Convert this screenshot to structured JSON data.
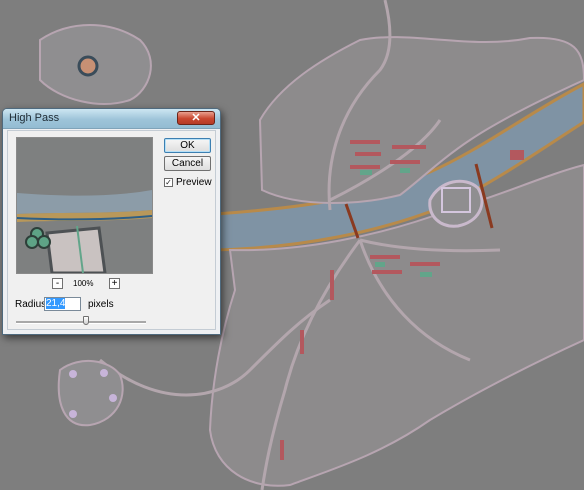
{
  "dialog": {
    "title": "High Pass",
    "close_glyph": "✕",
    "ok_label": "OK",
    "cancel_label": "Cancel",
    "preview_label": "Preview",
    "preview_checked": true,
    "check_glyph": "✓",
    "zoom_out": "-",
    "zoom_in": "+",
    "zoom_level": "100%",
    "radius_label": "Radius:",
    "radius_value": "21,4",
    "radius_unit": "pixels",
    "slider_position": 0.54
  },
  "colors": {
    "canvas_bg": "#7e7e7e",
    "river": "#7f93a4",
    "river_edge": "#b88a4a",
    "road": "#b3a6ad",
    "roof": "#b3585e",
    "green": "#62a58a"
  },
  "icons": [
    "close-icon",
    "check-icon",
    "zoom-out-icon",
    "zoom-in-icon"
  ]
}
